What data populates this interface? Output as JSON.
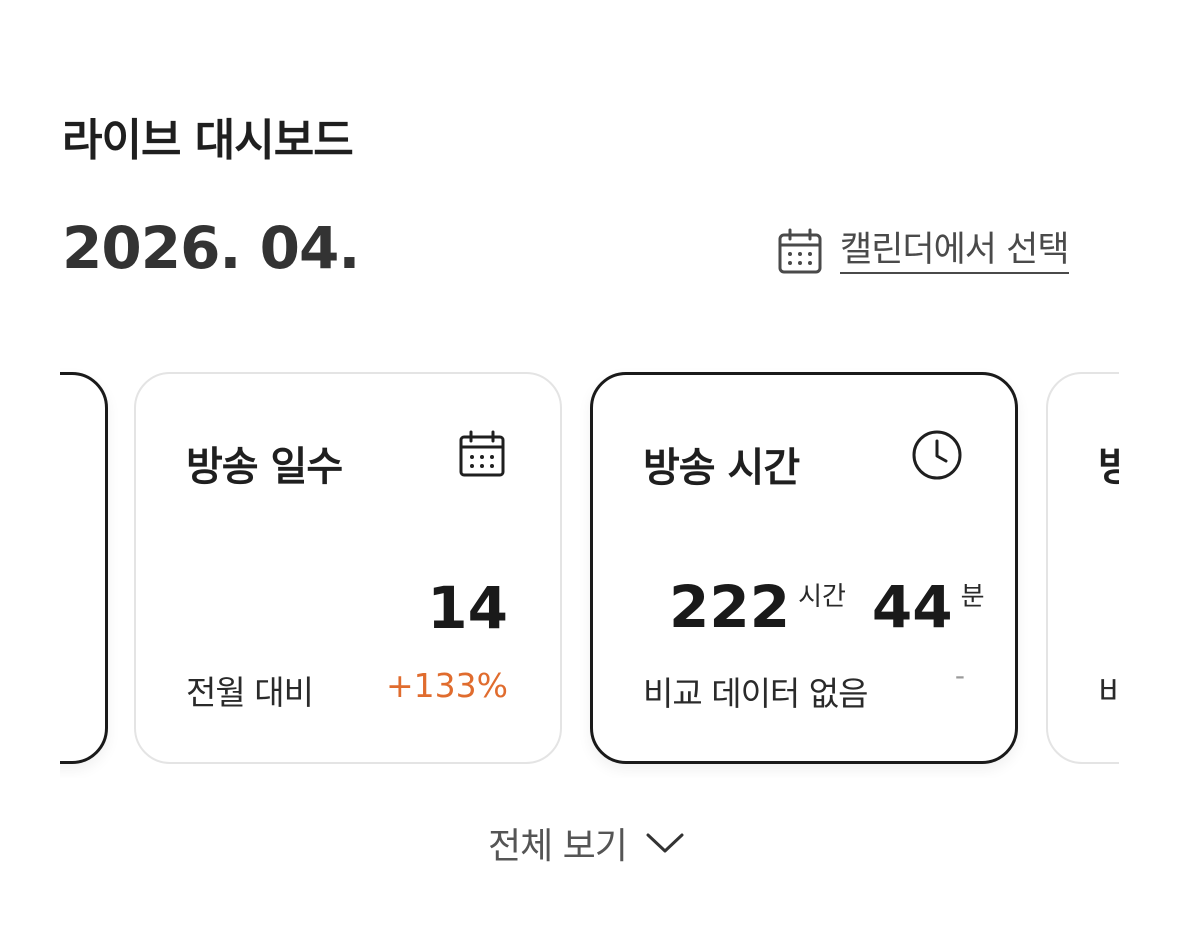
{
  "header": {
    "title": "라이브 대시보드"
  },
  "period": {
    "month_label": "2026. 04.",
    "calendar_link_label": "캘린더에서 선택",
    "calendar_icon": "calendar-icon"
  },
  "cards": [
    {
      "id": "prev-partial",
      "title": "",
      "active": true
    },
    {
      "id": "broadcast-days",
      "title": "방송 일수",
      "icon": "calendar-icon",
      "value": "14",
      "compare_label": "전월 대비",
      "compare_value": "+133%",
      "compare_color": "#e06c2e"
    },
    {
      "id": "broadcast-time",
      "title": "방송 시간",
      "icon": "clock-icon",
      "hours": "222",
      "hours_unit": "시간",
      "minutes": "44",
      "minutes_unit": "분",
      "compare_label": "비교 데이터 없음",
      "compare_value": "-",
      "active": true
    },
    {
      "id": "next-partial",
      "title_partial": "방",
      "compare_label_partial": "비"
    }
  ],
  "footer": {
    "view_all_label": "전체 보기",
    "view_all_icon": "chevron-down-icon"
  }
}
